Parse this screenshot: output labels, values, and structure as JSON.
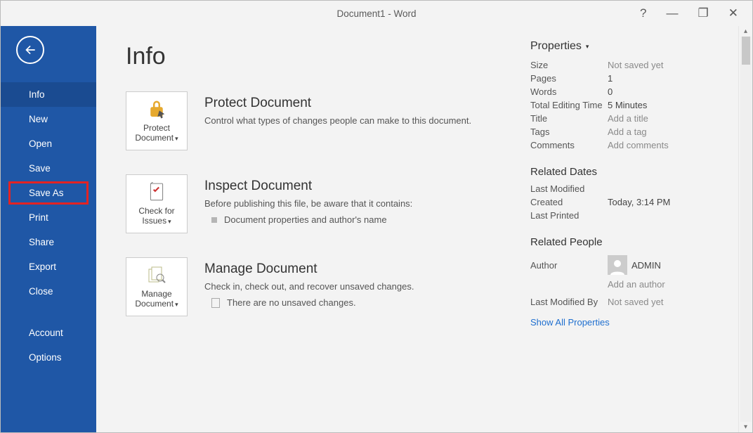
{
  "window": {
    "title": "Document1 - Word"
  },
  "titlebar": {
    "help": "?",
    "min": "—",
    "restore": "❐",
    "close": "✕"
  },
  "sidebar": {
    "items": [
      {
        "label": "Info",
        "selected": true
      },
      {
        "label": "New"
      },
      {
        "label": "Open"
      },
      {
        "label": "Save"
      },
      {
        "label": "Save As",
        "highlighted": true
      },
      {
        "label": "Print"
      },
      {
        "label": "Share"
      },
      {
        "label": "Export"
      },
      {
        "label": "Close"
      }
    ],
    "footer": [
      {
        "label": "Account"
      },
      {
        "label": "Options"
      }
    ]
  },
  "page": {
    "title": "Info"
  },
  "sections": {
    "protect": {
      "button": "Protect Document",
      "title": "Protect Document",
      "desc": "Control what types of changes people can make to this document."
    },
    "inspect": {
      "button": "Check for Issues",
      "title": "Inspect Document",
      "desc": "Before publishing this file, be aware that it contains:",
      "bullets": [
        "Document properties and author's name"
      ]
    },
    "manage": {
      "button": "Manage Document",
      "title": "Manage Document",
      "desc": "Check in, check out, and recover unsaved changes.",
      "note": "There are no unsaved changes."
    }
  },
  "properties": {
    "head": "Properties",
    "rows": [
      {
        "k": "Size",
        "v": "Not saved yet",
        "muted": true
      },
      {
        "k": "Pages",
        "v": "1"
      },
      {
        "k": "Words",
        "v": "0"
      },
      {
        "k": "Total Editing Time",
        "v": "5 Minutes"
      },
      {
        "k": "Title",
        "v": "Add a title",
        "muted": true,
        "interactable": true
      },
      {
        "k": "Tags",
        "v": "Add a tag",
        "muted": true,
        "interactable": true
      },
      {
        "k": "Comments",
        "v": "Add comments",
        "muted": true,
        "interactable": true
      }
    ],
    "dates": {
      "head": "Related Dates",
      "rows": [
        {
          "k": "Last Modified",
          "v": ""
        },
        {
          "k": "Created",
          "v": "Today, 3:14 PM"
        },
        {
          "k": "Last Printed",
          "v": ""
        }
      ]
    },
    "people": {
      "head": "Related People",
      "author_k": "Author",
      "author_name": "ADMIN",
      "add_author": "Add an author",
      "lastmod_k": "Last Modified By",
      "lastmod_v": "Not saved yet"
    },
    "show_all": "Show All Properties"
  }
}
